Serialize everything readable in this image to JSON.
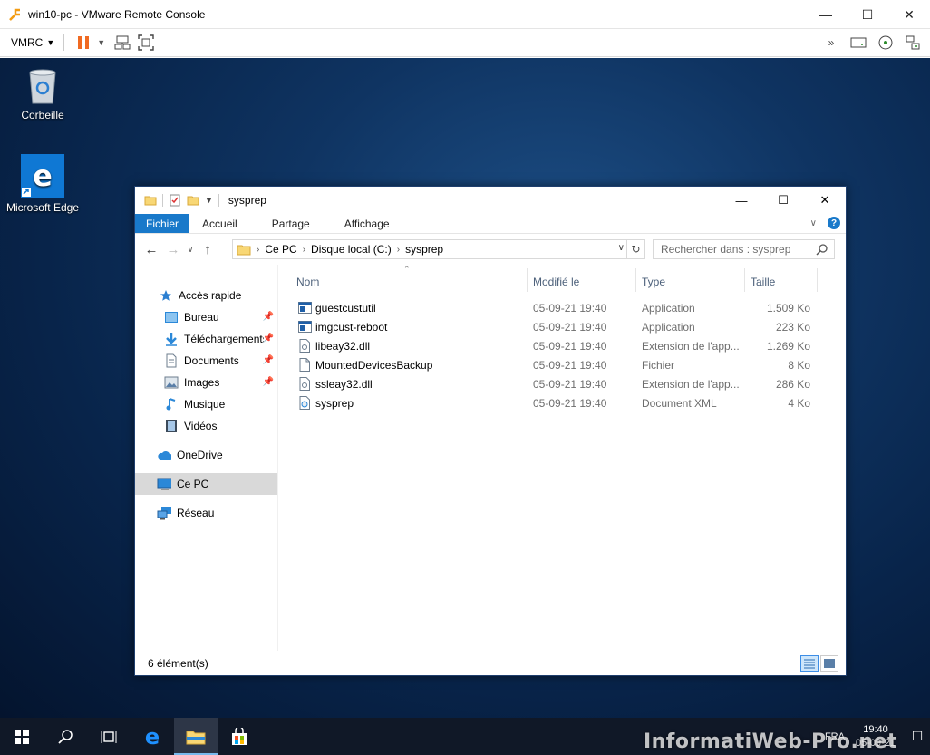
{
  "vmrc": {
    "title": "win10-pc - VMware Remote Console",
    "menu_label": "VMRC"
  },
  "desktop": {
    "icons": [
      {
        "label": "Corbeille"
      },
      {
        "label": "Microsoft Edge"
      }
    ]
  },
  "explorer": {
    "title": "sysprep",
    "ribbon_tabs": [
      "Fichier",
      "Accueil",
      "Partage",
      "Affichage"
    ],
    "breadcrumb": [
      "Ce PC",
      "Disque local (C:)",
      "sysprep"
    ],
    "search_placeholder": "Rechercher dans : sysprep",
    "nav": [
      {
        "label": "Accès rapide"
      },
      {
        "label": "Bureau"
      },
      {
        "label": "Téléchargements"
      },
      {
        "label": "Documents"
      },
      {
        "label": "Images"
      },
      {
        "label": "Musique"
      },
      {
        "label": "Vidéos"
      },
      {
        "label": "OneDrive"
      },
      {
        "label": "Ce PC"
      },
      {
        "label": "Réseau"
      }
    ],
    "columns": {
      "name": "Nom",
      "modified": "Modifié le",
      "type": "Type",
      "size": "Taille"
    },
    "files": [
      {
        "name": "guestcustutil",
        "modified": "05-09-21 19:40",
        "type": "Application",
        "size": "1.509 Ko"
      },
      {
        "name": "imgcust-reboot",
        "modified": "05-09-21 19:40",
        "type": "Application",
        "size": "223 Ko"
      },
      {
        "name": "libeay32.dll",
        "modified": "05-09-21 19:40",
        "type": "Extension de l'app...",
        "size": "1.269 Ko"
      },
      {
        "name": "MountedDevicesBackup",
        "modified": "05-09-21 19:40",
        "type": "Fichier",
        "size": "8 Ko"
      },
      {
        "name": "ssleay32.dll",
        "modified": "05-09-21 19:40",
        "type": "Extension de l'app...",
        "size": "286 Ko"
      },
      {
        "name": "sysprep",
        "modified": "05-09-21 19:40",
        "type": "Document XML",
        "size": "4 Ko"
      }
    ],
    "status": "6 élément(s)"
  },
  "taskbar": {
    "lang": "FRA",
    "time": "19:40",
    "date": "05-09-21"
  },
  "watermark": "InformatiWeb-Pro.net",
  "colors": {
    "accent": "#1979ca",
    "taskbar": "#101827",
    "file_icon_blue": "#1e5fa8"
  }
}
